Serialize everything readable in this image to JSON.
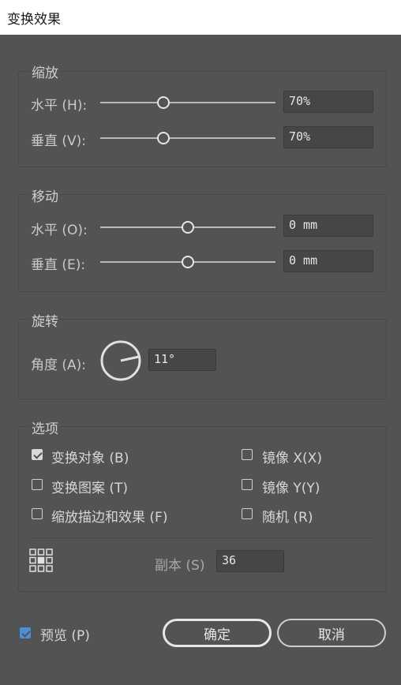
{
  "window": {
    "title": "变换效果"
  },
  "scale": {
    "legend": "缩放",
    "horizontal": {
      "label": "水平 (H):",
      "value": "70%",
      "slider_fraction": 0.35
    },
    "vertical": {
      "label": "垂直 (V):",
      "value": "70%",
      "slider_fraction": 0.35
    }
  },
  "move": {
    "legend": "移动",
    "horizontal": {
      "label": "水平 (O):",
      "value": "0 mm",
      "slider_fraction": 0.5
    },
    "vertical": {
      "label": "垂直 (E):",
      "value": "0 mm",
      "slider_fraction": 0.5
    }
  },
  "rotate": {
    "legend": "旋转",
    "angle_label": "角度 (A):",
    "angle_value": "11°"
  },
  "options": {
    "legend": "选项",
    "transform_objects": {
      "label": "变换对象 (B)",
      "checked": true
    },
    "transform_patterns": {
      "label": "变换图案 (T)",
      "checked": false
    },
    "scale_strokes": {
      "label": "缩放描边和效果 (F)",
      "checked": false
    },
    "reflect_x": {
      "label": "镜像 X(X)",
      "checked": false
    },
    "reflect_y": {
      "label": "镜像 Y(Y)",
      "checked": false
    },
    "random": {
      "label": "随机 (R)",
      "checked": false
    },
    "copies_label": "副本 (S)",
    "copies_value": "36"
  },
  "footer": {
    "preview": {
      "label": "预览 (P)",
      "checked": true
    },
    "ok_label": "确定",
    "cancel_label": "取消"
  },
  "colors": {
    "background": "#535353",
    "accent": "#4a90d9",
    "titlebar": "#ffffff"
  }
}
